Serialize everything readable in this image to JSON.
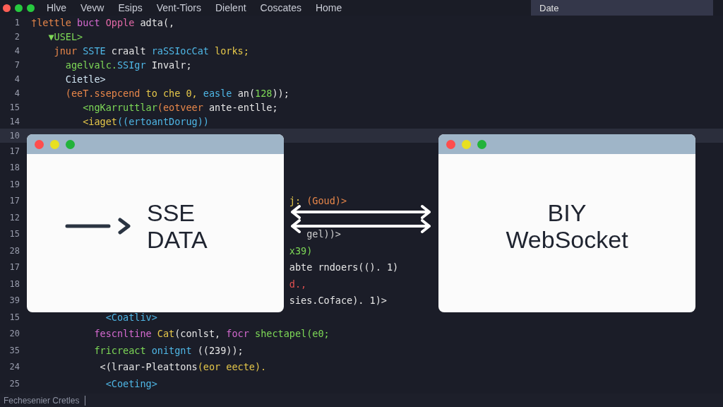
{
  "menu": [
    "Hlve",
    "Vevw",
    "Esips",
    "Vent-Tiors",
    "Dielent",
    "Coscates",
    "Home"
  ],
  "tab": {
    "label": "Date"
  },
  "code_lines": [
    {
      "number": "1",
      "current": false,
      "tokens": [
        {
          "text": "†lettle",
          "color": "#e8874a"
        },
        {
          "text": " buct ",
          "color": "#d56ad0"
        },
        {
          "text": "Opple",
          "color": "#e46aa8"
        },
        {
          "text": " adta(,",
          "color": "#e6e6e6"
        }
      ]
    },
    {
      "number": "2",
      "current": false,
      "tokens": [
        {
          "text": "   ▼USEL>",
          "color": "#7ed957"
        }
      ]
    },
    {
      "number": "4",
      "current": false,
      "tokens": [
        {
          "text": "    jnur ",
          "color": "#e8874a"
        },
        {
          "text": "SSTE ",
          "color": "#4fb7e6"
        },
        {
          "text": "craalt ",
          "color": "#e6e6e6"
        },
        {
          "text": "raSSIocCat ",
          "color": "#4fb7e6"
        },
        {
          "text": "lorks;",
          "color": "#e6c84a"
        }
      ]
    },
    {
      "number": "7",
      "current": false,
      "tokens": [
        {
          "text": "      agelvalc.",
          "color": "#7ed957"
        },
        {
          "text": "SSIgr ",
          "color": "#4fb7e6"
        },
        {
          "text": "Invalr;",
          "color": "#e6e6e6"
        }
      ]
    },
    {
      "number": "4",
      "current": false,
      "tokens": [
        {
          "text": "      Cietle>",
          "color": "#cfe3f0"
        }
      ]
    },
    {
      "number": "4",
      "current": false,
      "tokens": [
        {
          "text": "      (eeT.ssepcend ",
          "color": "#e8874a"
        },
        {
          "text": "to che 0, ",
          "color": "#e6c84a"
        },
        {
          "text": "easle ",
          "color": "#4fb7e6"
        },
        {
          "text": "an(",
          "color": "#e6e6e6"
        },
        {
          "text": "128",
          "color": "#7ed957"
        },
        {
          "text": "));",
          "color": "#e6e6e6"
        }
      ]
    },
    {
      "number": "15",
      "current": false,
      "tokens": [
        {
          "text": "         <ngKarruttlar",
          "color": "#7ed957"
        },
        {
          "text": "(eotveer ",
          "color": "#e8874a"
        },
        {
          "text": "ante-entlle;",
          "color": "#e6e6e6"
        }
      ]
    },
    {
      "number": "14",
      "current": false,
      "tokens": [
        {
          "text": "         <iaget",
          "color": "#e6c84a"
        },
        {
          "text": "((ertoantDorug))",
          "color": "#4fb7e6"
        }
      ]
    },
    {
      "number": "10",
      "current": true
    },
    {
      "number": "17",
      "current": false
    },
    {
      "number": "18",
      "current": false
    },
    {
      "number": "19",
      "current": false
    },
    {
      "number": "17",
      "current": false,
      "tokens": [
        {
          "text": "                                             j: ",
          "color": "#e6c84a"
        },
        {
          "text": "(Goud)>",
          "color": "#e8874a"
        }
      ]
    },
    {
      "number": "12",
      "current": false
    },
    {
      "number": "15",
      "current": false,
      "tokens": [
        {
          "text": "                                                gel))>",
          "color": "#cfcfcf"
        }
      ]
    },
    {
      "number": "28",
      "current": false,
      "tokens": [
        {
          "text": "                                             x39)",
          "color": "#7ed957"
        }
      ]
    },
    {
      "number": "17",
      "current": false,
      "tokens": [
        {
          "text": "                                             abte rndoers((). 1)",
          "color": "#e6e6e6"
        }
      ]
    },
    {
      "number": "18",
      "current": false,
      "tokens": [
        {
          "text": "                                             d.,",
          "color": "#e05050"
        }
      ]
    },
    {
      "number": "39",
      "current": false,
      "tokens": [
        {
          "text": "                                             sies.Coface). 1)>",
          "color": "#e6e6e6"
        }
      ]
    },
    {
      "number": "15",
      "current": false,
      "tokens": [
        {
          "text": "             <Coatliv>",
          "color": "#4fb7e6"
        }
      ]
    },
    {
      "number": "20",
      "current": false,
      "tokens": [
        {
          "text": "           fescnltine ",
          "color": "#d56ad0"
        },
        {
          "text": "Cat",
          "color": "#e6c84a"
        },
        {
          "text": "(conlst, ",
          "color": "#e6e6e6"
        },
        {
          "text": "focr ",
          "color": "#d56ad0"
        },
        {
          "text": "shectapel(e0;",
          "color": "#7ed957"
        }
      ]
    },
    {
      "number": "35",
      "current": false,
      "tokens": [
        {
          "text": "           fricreact ",
          "color": "#7ed957"
        },
        {
          "text": "onitgnt ",
          "color": "#4fb7e6"
        },
        {
          "text": "((239));",
          "color": "#e6e6e6"
        }
      ]
    },
    {
      "number": "24",
      "current": false,
      "tokens": [
        {
          "text": "            <(lraar-Pleattons",
          "color": "#e6e6e6"
        },
        {
          "text": "(eor eecte).",
          "color": "#e6c84a"
        }
      ]
    },
    {
      "number": "25",
      "current": false,
      "tokens": [
        {
          "text": "             <Coeting>",
          "color": "#4fb7e6"
        }
      ]
    }
  ],
  "windows": [
    {
      "kind": "with-arrow",
      "label_lines": [
        "SSE",
        "DATA"
      ]
    },
    {
      "kind": "plain",
      "label_lines": [
        "BIY",
        "WebSocket"
      ]
    }
  ],
  "status_bar": {
    "text": "Fechesenier Cretles"
  }
}
